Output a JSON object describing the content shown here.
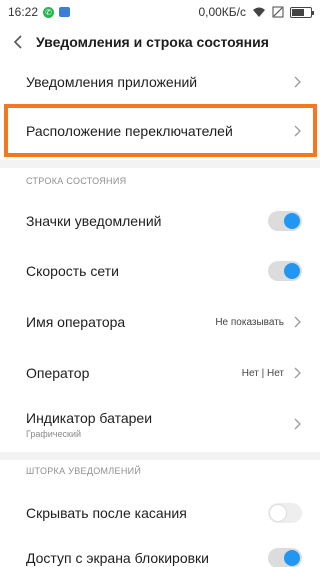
{
  "status": {
    "time": "16:22",
    "speed": "0,00КБ/с",
    "icons": [
      "phone-call-icon",
      "message-icon",
      "wifi-icon",
      "no-sim-icon",
      "battery-icon"
    ]
  },
  "appbar": {
    "title": "Уведомления и строка состояния"
  },
  "rows": {
    "app_notifications": "Уведомления приложений",
    "toggle_layout": "Расположение переключателей",
    "notif_icons": "Значки уведомлений",
    "net_speed": "Скорость сети",
    "operator_name": "Имя оператора",
    "operator_name_value": "Не показывать",
    "operator": "Оператор",
    "operator_value": "Нет | Нет",
    "battery_indicator": "Индикатор батареи",
    "battery_indicator_sub": "Графический",
    "hide_after_tap": "Скрывать после касания",
    "lock_access": "Доступ с экрана блокировки"
  },
  "sections": {
    "status_bar": "СТРОКА СОСТОЯНИЯ",
    "notif_shade": "ШТОРКА УВЕДОМЛЕНИЙ"
  },
  "toggles": {
    "notif_icons": true,
    "net_speed": true,
    "hide_after_tap": false,
    "lock_access": true
  },
  "colors": {
    "accent": "#2196f3",
    "highlight": "#f3781f"
  }
}
